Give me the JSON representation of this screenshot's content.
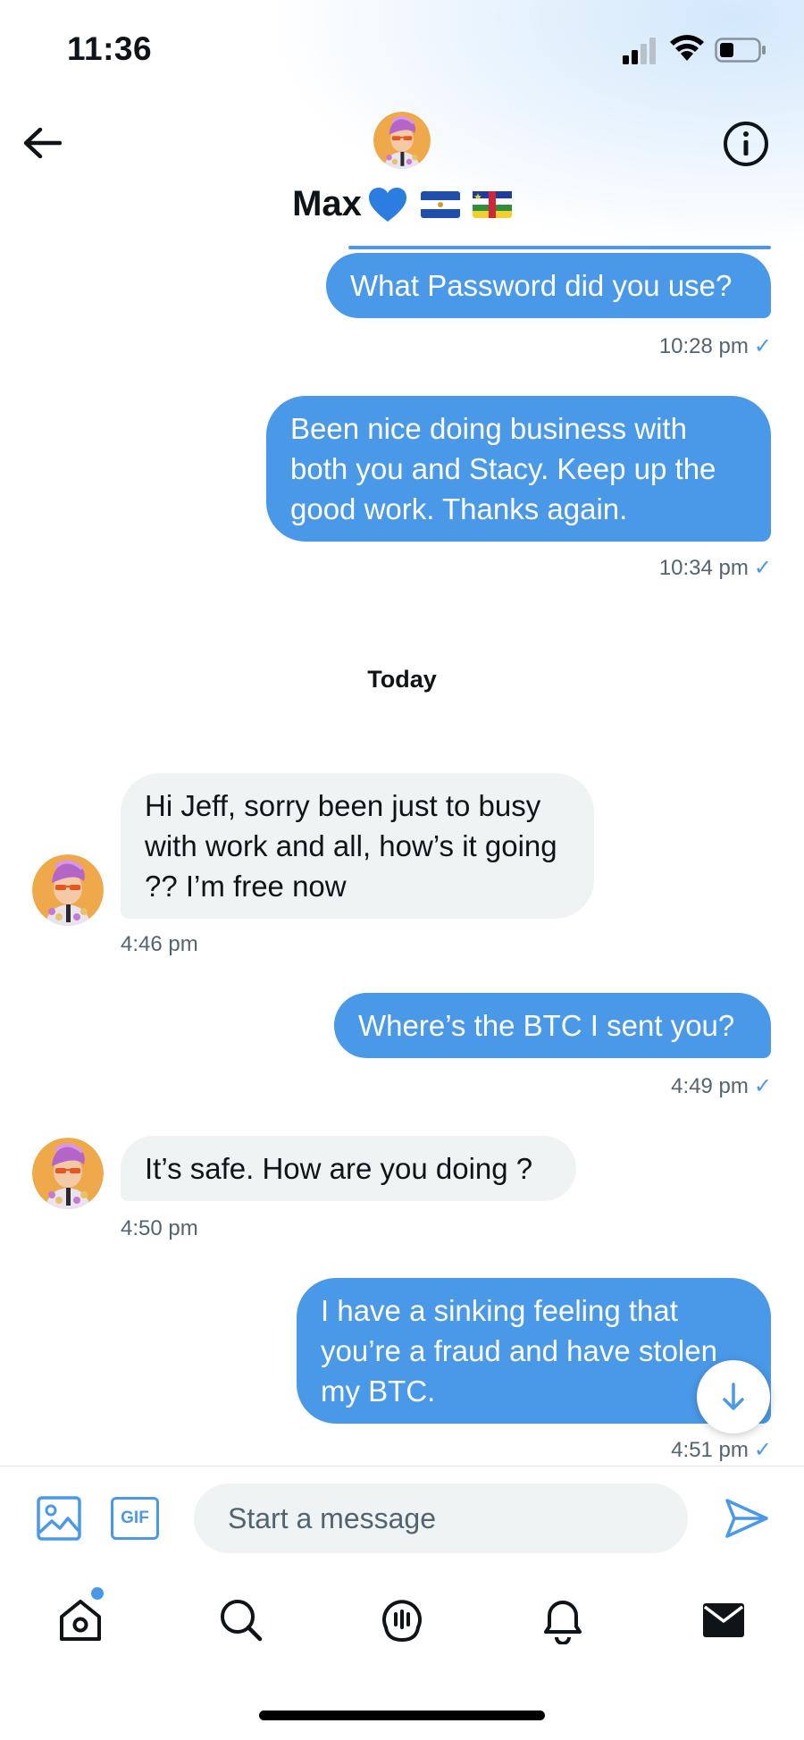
{
  "status_bar": {
    "time": "11:36"
  },
  "header": {
    "name": "Max",
    "heart_icon": "blue-heart-emoji",
    "flags": [
      "el-salvador-flag",
      "central-african-republic-flag"
    ]
  },
  "messages": [
    {
      "direction": "out",
      "text": "What Password did you use?",
      "time": "10:28 pm",
      "read": "✓"
    },
    {
      "direction": "out",
      "text": "Been nice doing business with both you and Stacy. Keep up the good work. Thanks again.",
      "time": "10:34 pm",
      "read": "✓"
    },
    {
      "direction": "in",
      "text": "Hi Jeff, sorry been just to busy with work and all, how’s it going ?? I’m free now",
      "time": "4:46 pm"
    },
    {
      "direction": "out",
      "text": "Where’s the BTC I sent you?",
      "time": "4:49 pm",
      "read": "✓"
    },
    {
      "direction": "in",
      "text": "It’s safe. How are you doing ?",
      "time": "4:50 pm"
    },
    {
      "direction": "out",
      "text": "I have a sinking feeling that you’re a fraud and have stolen my BTC.",
      "time": "4:51 pm",
      "read": "✓"
    }
  ],
  "day_separator": "Today",
  "composer": {
    "gif_label": "GIF",
    "placeholder": "Start a message"
  },
  "tabbar": {
    "items": [
      "home-icon",
      "search-icon",
      "spaces-icon",
      "notifications-icon",
      "messages-icon"
    ]
  },
  "colors": {
    "accent": "#4a99e9",
    "incoming_bubble": "#eff3f4",
    "text": "#0f1419",
    "muted": "#536471"
  }
}
